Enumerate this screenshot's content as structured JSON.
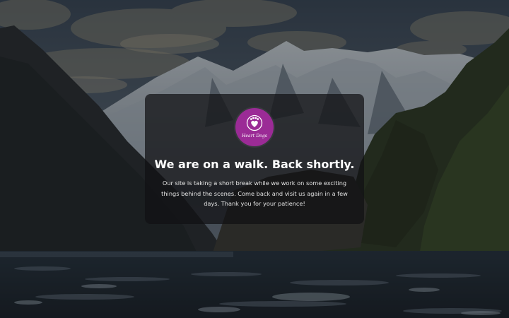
{
  "brand": {
    "logo_text": "Heart Dogs",
    "logo_color": "#9b2b96",
    "logo_icon": "paw-heart-icon"
  },
  "maintenance": {
    "headline": "We are on a walk. Back shortly.",
    "message": "Our site is taking a short break while we work on some exciting things behind the scenes. Come back and visit us again in a few days. Thank you for your patience!"
  },
  "background": {
    "description_icon": "mountain-fjord-background",
    "overlay_color": "#101113"
  }
}
